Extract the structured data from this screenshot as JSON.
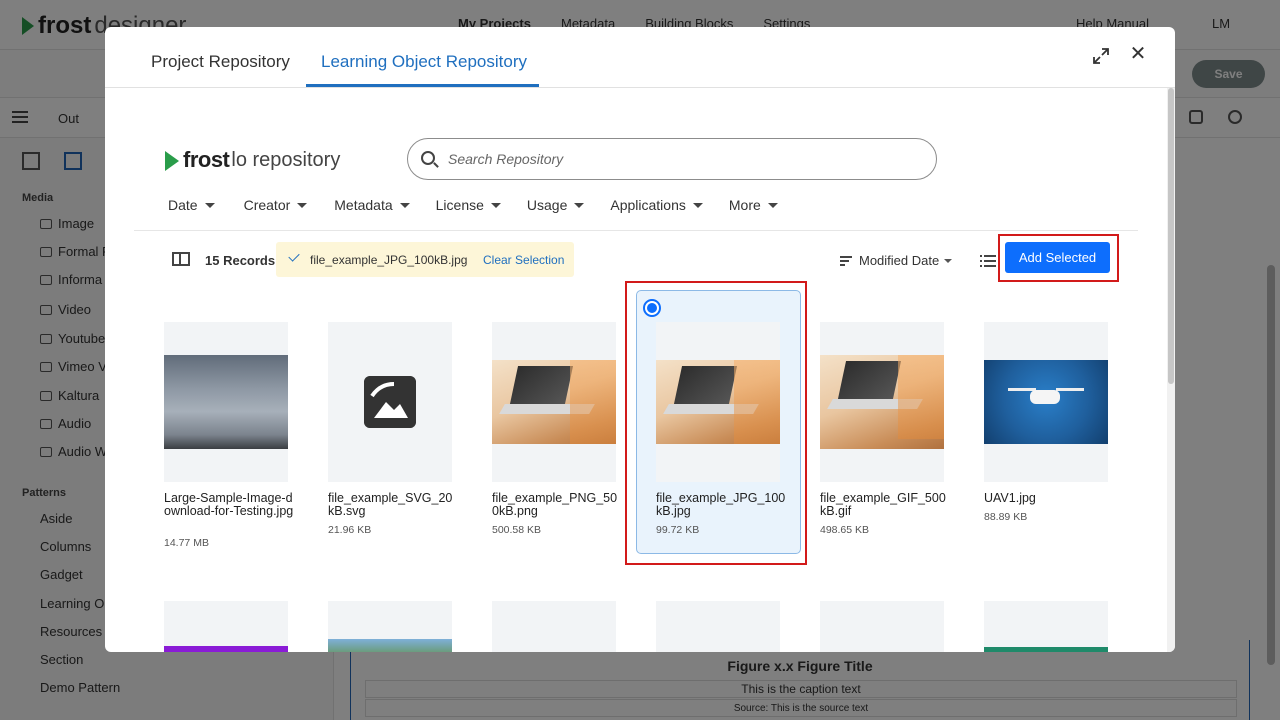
{
  "app": {
    "logo_bold": "frost",
    "logo_light": "designer",
    "nav": [
      "My Projects",
      "Metadata",
      "Building Blocks",
      "Settings"
    ],
    "help": "Help Manual",
    "user": "LM",
    "save": "Save",
    "outline": "Out",
    "sidebar_media_title": "Media",
    "media_items": [
      "Image",
      "Formal F",
      "Informa",
      "Video",
      "Youtube",
      "Vimeo V",
      "Kaltura",
      "Audio",
      "Audio W"
    ],
    "sidebar_patterns_title": "Patterns",
    "pattern_items": [
      "Aside",
      "Columns",
      "Gadget",
      "Learning O",
      "Resources",
      "Section",
      "Demo Pattern"
    ],
    "figure_title": "Figure x.x Figure Title",
    "figure_caption": "This is the caption text",
    "figure_source": "Source:  This is the source text"
  },
  "modal": {
    "tabs": [
      "Project Repository",
      "Learning Object Repository"
    ],
    "active_tab": 1,
    "close_glyph": "✕",
    "repo_logo_bold": "frost",
    "repo_logo_light": "lo repository",
    "search": {
      "placeholder": "Search Repository",
      "value": ""
    },
    "filters": [
      "Date",
      "Creator",
      "Metadata",
      "License",
      "Usage",
      "Applications",
      "More"
    ],
    "records": "15 Records",
    "selection": {
      "file": "file_example_JPG_100kB.jpg",
      "clear": "Clear Selection"
    },
    "sort": "Modified Date",
    "add_selected": "Add Selected",
    "cards": [
      {
        "name": "Large-Sample-Image-download-for-Testing.jpg",
        "size": "14.77 MB",
        "thumb": "sky"
      },
      {
        "name": "file_example_SVG_20kB.svg",
        "size": "21.96 KB",
        "thumb": "svg-icon"
      },
      {
        "name": "file_example_PNG_500kB.png",
        "size": "500.58 KB",
        "thumb": "laptop"
      },
      {
        "name": "file_example_JPG_100kB.jpg",
        "size": "99.72 KB",
        "thumb": "laptop",
        "selected": true
      },
      {
        "name": "file_example_GIF_500kB.gif",
        "size": "498.65 KB",
        "thumb": "laptop"
      },
      {
        "name": "UAV1.jpg",
        "size": "88.89 KB",
        "thumb": "drone"
      }
    ],
    "colors": {
      "accent": "#1f6fbf",
      "button": "#0d6efd",
      "highlight": "#d21a1a",
      "chip": "#fdf6d8",
      "selected_card": "#e9f3fc"
    }
  }
}
